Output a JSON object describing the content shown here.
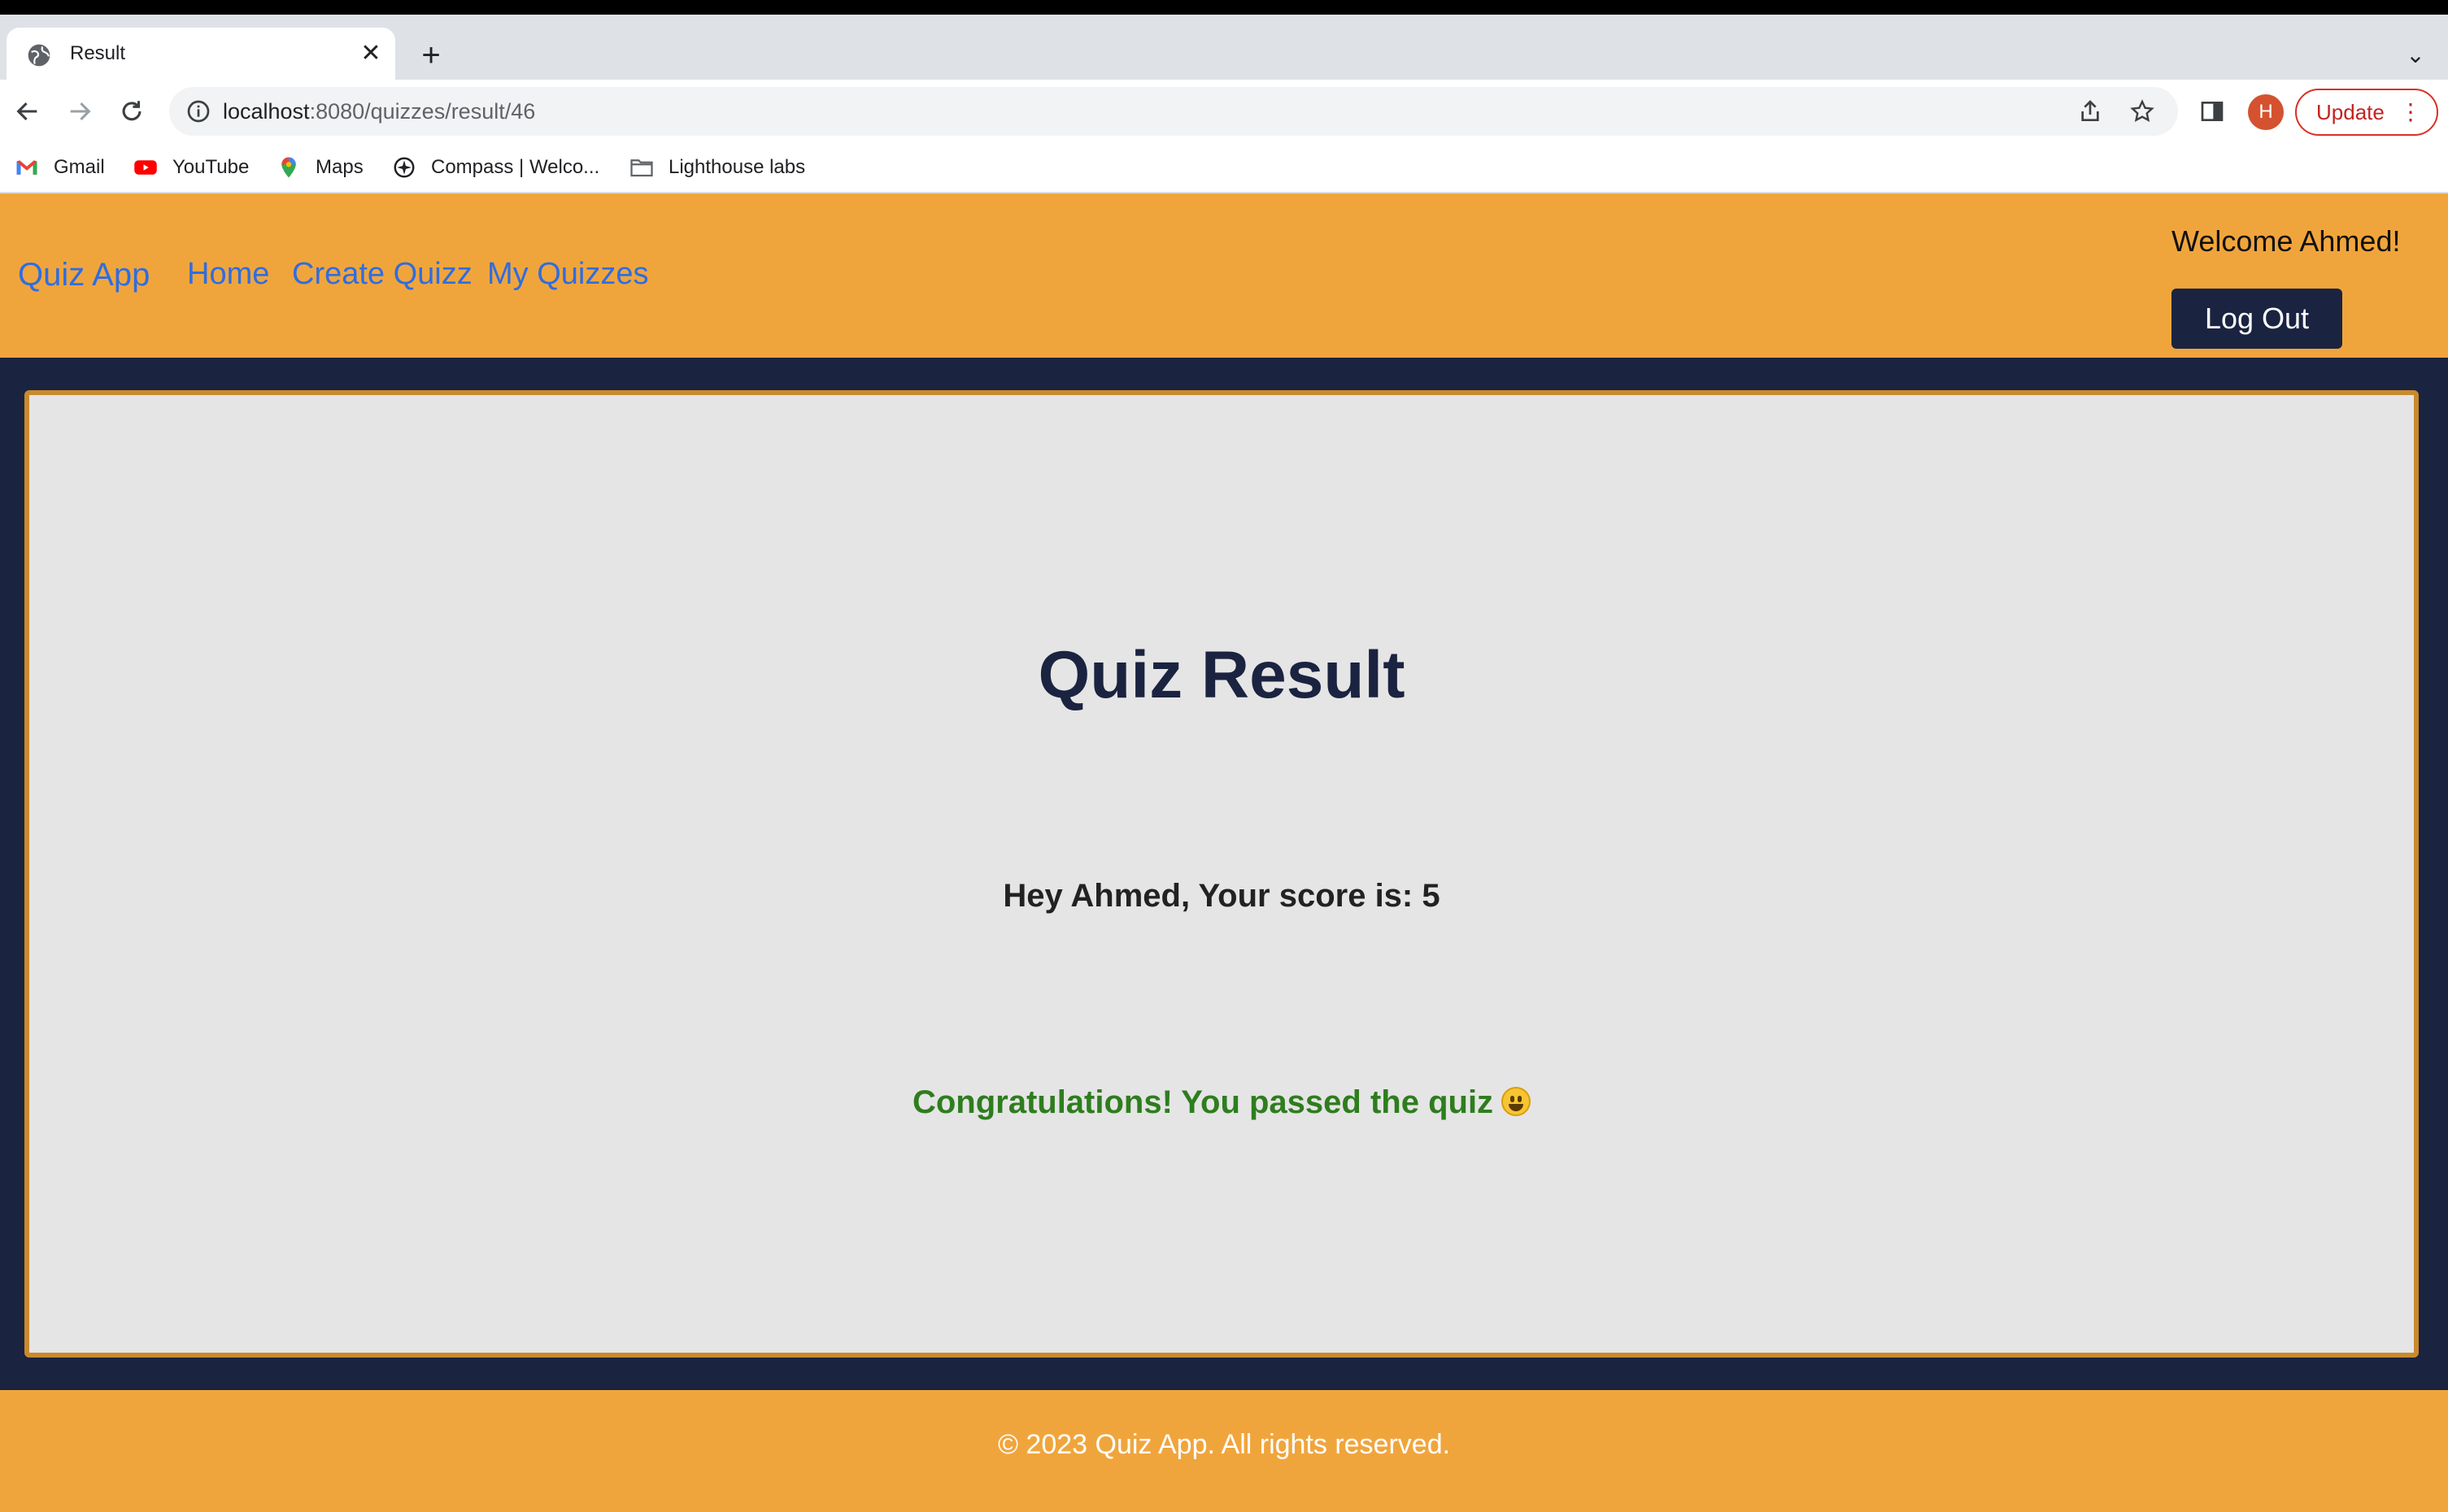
{
  "browser": {
    "tab_title": "Result",
    "tab_close": "✕",
    "new_tab": "+",
    "tab_search": "⌄",
    "url_host": "localhost",
    "url_rest": ":8080/quizzes/result/46",
    "profile_initial": "H",
    "update_label": "Update",
    "menu_dots": "⋮",
    "bookmarks": [
      {
        "label": "Gmail",
        "icon": "gmail-icon"
      },
      {
        "label": "YouTube",
        "icon": "youtube-icon"
      },
      {
        "label": "Maps",
        "icon": "maps-icon"
      },
      {
        "label": "Compass | Welco...",
        "icon": "compass-icon"
      },
      {
        "label": "Lighthouse labs",
        "icon": "folder-icon"
      }
    ]
  },
  "header": {
    "brand": "Quiz App",
    "nav": [
      {
        "label": "Home"
      },
      {
        "label": "Create Quizz"
      },
      {
        "label": "My Quizzes"
      }
    ],
    "welcome": "Welcome Ahmed!",
    "logout_label": "Log Out"
  },
  "main": {
    "title": "Quiz Result",
    "score_text": "Hey Ahmed, Your score is: 5",
    "result_message": "Congratulations! You passed the quiz"
  },
  "footer": {
    "text": "© 2023 Quiz App. All rights reserved."
  },
  "colors": {
    "header_bg": "#f0a53c",
    "page_bg": "#1a2340",
    "card_bg": "#e5e5e5",
    "link": "#2f6de0",
    "success": "#2e7d1e"
  }
}
